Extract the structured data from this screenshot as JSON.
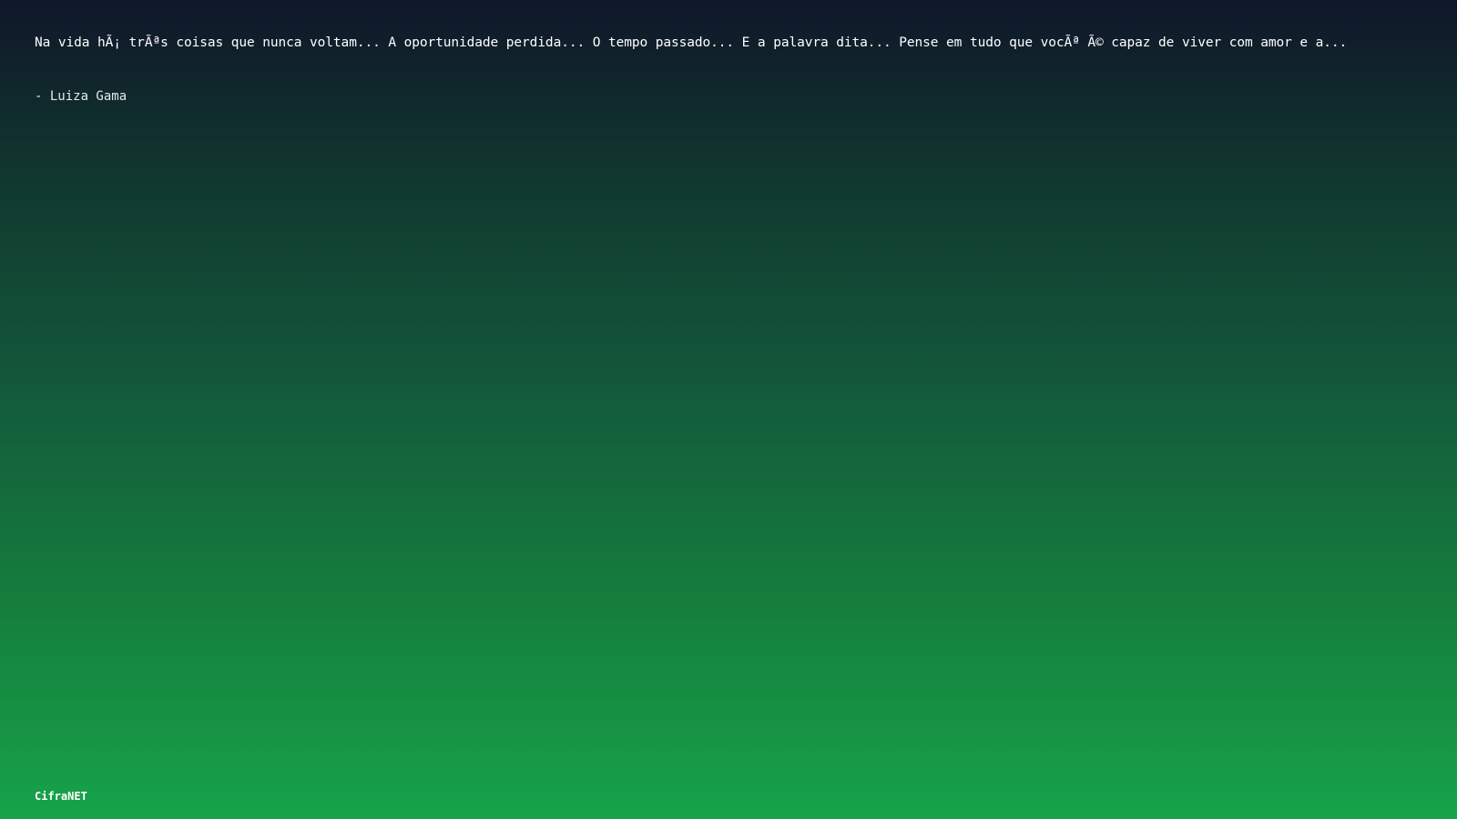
{
  "quote": {
    "text": "Na vida hÃ¡ trÃªs coisas que nunca voltam... A oportunidade perdida... O tempo passado... E a palavra dita... Pense em tudo que vocÃª Ã© capaz de viver com amor e a...",
    "author": "- Luiza Gama"
  },
  "footer": {
    "brand": "CifraNET"
  },
  "colors": {
    "background_top": "#0f172a",
    "background_bottom": "#16a34a",
    "text": "#ffffff"
  }
}
